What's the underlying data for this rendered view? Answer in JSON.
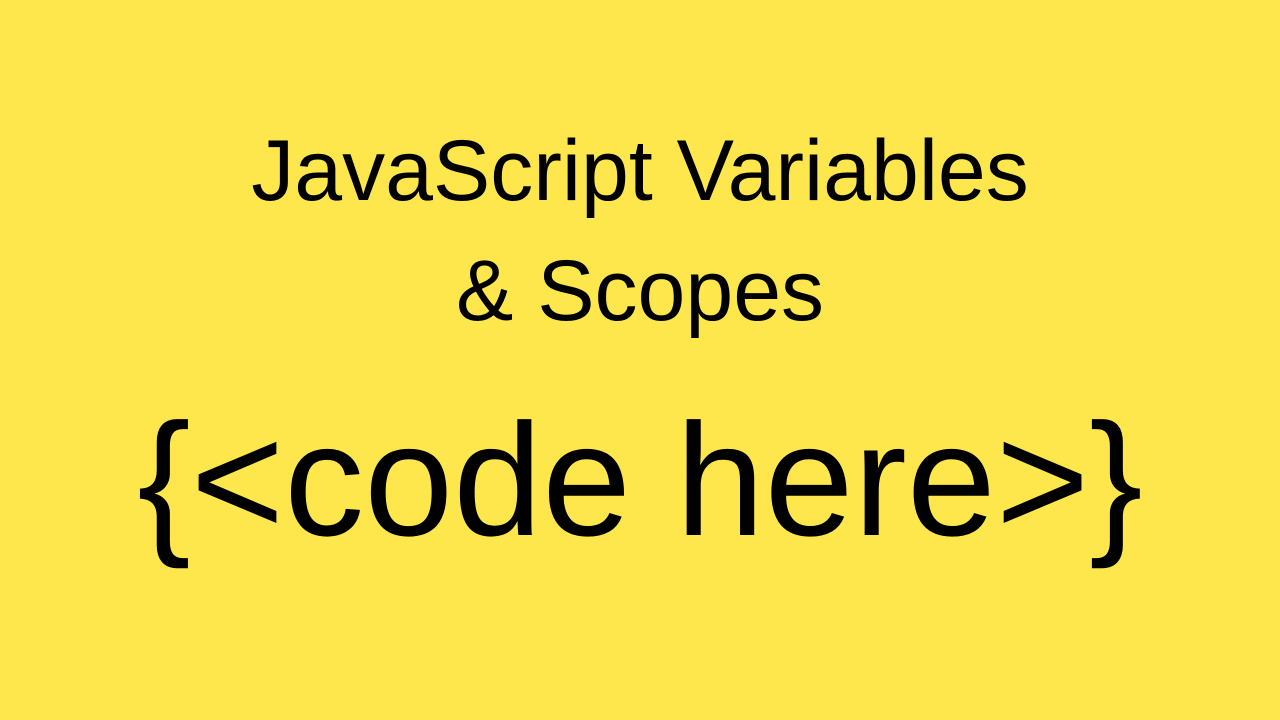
{
  "title": {
    "line1": "JavaScript Variables",
    "line2": "& Scopes"
  },
  "code_text": "{<code here>}",
  "colors": {
    "background": "#FDE74C",
    "text": "#000000"
  }
}
